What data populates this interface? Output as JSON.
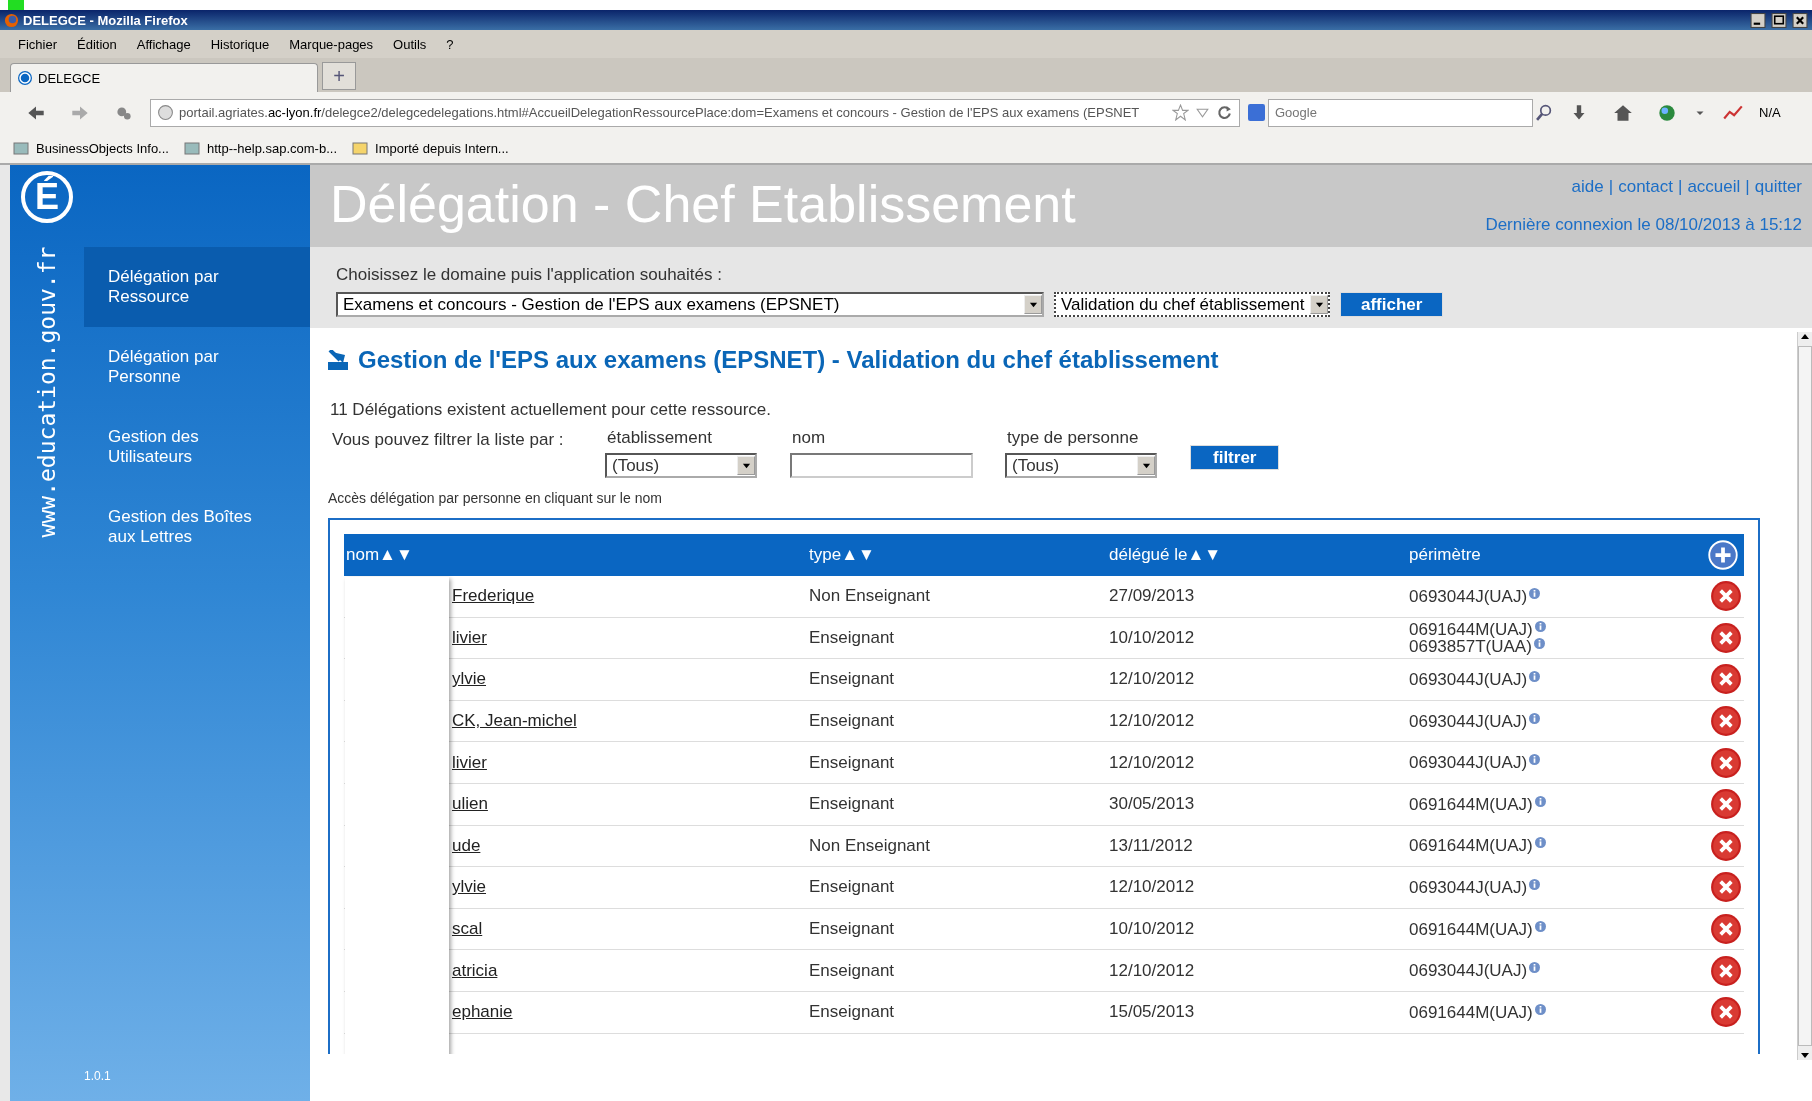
{
  "window": {
    "title": "DELEGCE - Mozilla Firefox"
  },
  "menu": [
    "Fichier",
    "Édition",
    "Affichage",
    "Historique",
    "Marque-pages",
    "Outils",
    "?"
  ],
  "tabs": [
    {
      "label": "DELEGCE",
      "selected": true
    }
  ],
  "new_tab": "+",
  "address_bar": {
    "url": "portail.agriates.**ac-lyon.fr**/delegce2/delegcedelegations.html#AccueilDelegationRessourcePlace:dom=Examens et concours - Gestion de l'EPS aux examens (EPSNET"
  },
  "search": {
    "placeholder": "Google"
  },
  "toolbar_label": "N/A",
  "bookmarks": [
    "BusinessObjects Info...",
    "http--help.sap.com-b...",
    "Importé depuis Intern..."
  ],
  "sidebar": {
    "logo": "É",
    "site": "www.education.gouv.fr",
    "version": "1.0.1",
    "items": [
      {
        "label": "Délégation par Ressource",
        "selected": true
      },
      {
        "label": "Délégation par Personne",
        "selected": false
      },
      {
        "label": "Gestion des Utilisateurs",
        "selected": false
      },
      {
        "label": "Gestion des Boîtes aux Lettres",
        "selected": false
      }
    ]
  },
  "header": {
    "title": "Délégation - Chef Etablissement",
    "links": [
      "aide",
      "contact",
      "accueil",
      "quitter"
    ],
    "link_separator": "|",
    "last_login": "Dernière connexion le 08/10/2013 à 15:12"
  },
  "selector": {
    "label": "Choisissez le domaine puis l'application souhaités :",
    "domain": "Examens et concours - Gestion de l'EPS aux examens (EPSNET)",
    "application": "Validation du chef établissement",
    "button": "afficher"
  },
  "section": {
    "title": "Gestion de l'EPS aux examens (EPSNET) - Validation du chef établissement",
    "count_text": "11 Délégations existent actuellement pour cette ressource.",
    "filter_intro": "Vous pouvez filtrer la liste par :",
    "filter_button": "filtrer",
    "hint": "Accès délégation par personne en cliquant sur le nom",
    "filters": [
      {
        "label": "établissement",
        "kind": "select",
        "value": "(Tous)"
      },
      {
        "label": "nom",
        "kind": "text"
      },
      {
        "label": "type de personne",
        "kind": "select",
        "value": "(Tous)"
      }
    ]
  },
  "table": {
    "columns": [
      {
        "label": "nom",
        "sort": "▲▼"
      },
      {
        "label": "type",
        "sort": "▲▼"
      },
      {
        "label": "délégué le",
        "sort": "▲▼"
      },
      {
        "label": "périmètre"
      }
    ],
    "rows": [
      {
        "nom": "Frederique",
        "type": "Non Enseignant",
        "date": "27/09/2013",
        "perimetre": [
          "0693044J(UAJ)"
        ]
      },
      {
        "nom": "livier",
        "type": "Enseignant",
        "date": "10/10/2012",
        "perimetre": [
          "0691644M(UAJ)",
          "0693857T(UAA)"
        ]
      },
      {
        "nom": "ylvie",
        "type": "Enseignant",
        "date": "12/10/2012",
        "perimetre": [
          "0693044J(UAJ)"
        ]
      },
      {
        "nom": "CK, Jean-michel",
        "type": "Enseignant",
        "date": "12/10/2012",
        "perimetre": [
          "0693044J(UAJ)"
        ]
      },
      {
        "nom": "livier",
        "type": "Enseignant",
        "date": "12/10/2012",
        "perimetre": [
          "0693044J(UAJ)"
        ]
      },
      {
        "nom": "ulien",
        "type": "Enseignant",
        "date": "30/05/2013",
        "perimetre": [
          "0691644M(UAJ)"
        ]
      },
      {
        "nom": "ude",
        "type": "Non Enseignant",
        "date": "13/11/2012",
        "perimetre": [
          "0691644M(UAJ)"
        ]
      },
      {
        "nom": "ylvie",
        "type": "Enseignant",
        "date": "12/10/2012",
        "perimetre": [
          "0693044J(UAJ)"
        ]
      },
      {
        "nom": "scal",
        "type": "Enseignant",
        "date": "10/10/2012",
        "perimetre": [
          "0691644M(UAJ)"
        ]
      },
      {
        "nom": "atricia",
        "type": "Enseignant",
        "date": "12/10/2012",
        "perimetre": [
          "0693044J(UAJ)"
        ]
      },
      {
        "nom": "ephanie",
        "type": "Enseignant",
        "date": "15/05/2013",
        "perimetre": [
          "0691644M(UAJ)"
        ]
      }
    ]
  }
}
